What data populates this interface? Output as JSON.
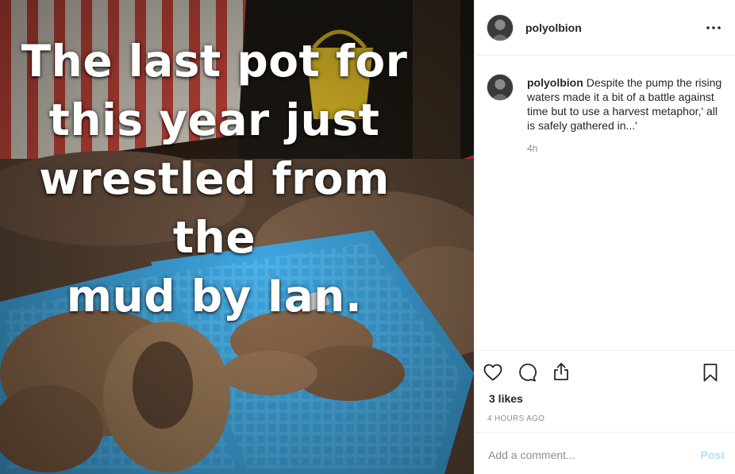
{
  "post": {
    "image_caption_lines": [
      "The last pot for",
      "this year just",
      "wrestled from the",
      "mud by Ian."
    ],
    "author": {
      "username": "polyolbion",
      "avatar_icon": "profile-avatar-icon"
    },
    "more_icon": "more-options-icon",
    "comment": {
      "username": "polyolbion",
      "text": "Despite the pump the rising waters made it a bit of a battle against time but to use a harvest metaphor,' all is safely gathered in...'",
      "time": "4h"
    },
    "actions": {
      "like_icon": "heart-icon",
      "comment_icon": "comment-bubble-icon",
      "share_icon": "share-icon",
      "save_icon": "bookmark-icon"
    },
    "likes": "3 likes",
    "timestamp": "4 HOURS AGO",
    "add_comment": {
      "placeholder": "Add a comment...",
      "post_label": "Post"
    }
  },
  "colors": {
    "text_primary": "#262626",
    "text_secondary": "#8e8e8e",
    "border": "#efefef",
    "post_button_disabled": "#b2dffc",
    "crate_blue": "#3fa6e0",
    "crate_red": "#e8313a"
  }
}
